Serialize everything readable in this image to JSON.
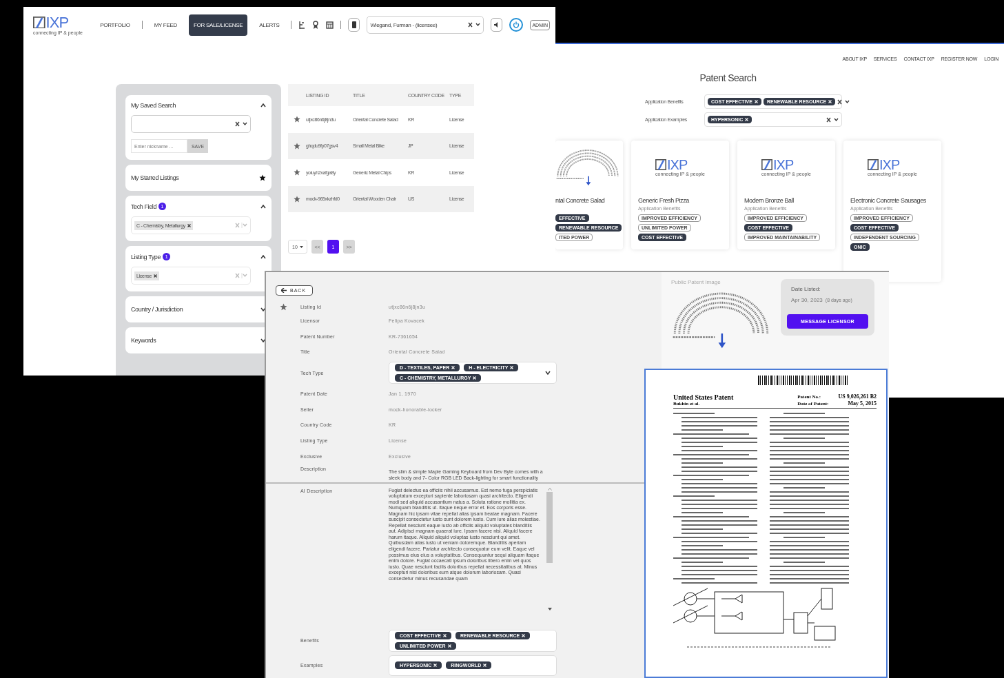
{
  "app_window": {
    "logo": {
      "mark": "IXP",
      "tagline": "connecting IP & people"
    },
    "nav": [
      {
        "label": "PORTFOLIO",
        "selected": false
      },
      {
        "label": "MY FEED",
        "selected": false
      },
      {
        "label": "FOR SALE/LICENSE",
        "selected": true
      },
      {
        "label": "ALERTS",
        "selected": false
      }
    ],
    "user_select": {
      "value": "Wiegand, Furman - (licensee)"
    },
    "admin": "ADMIN",
    "filters": [
      {
        "kind": "saved_search",
        "title": "My Saved Search",
        "expanded": true,
        "nickname_placeholder": "Enter nickname ...",
        "save": "SAVE"
      },
      {
        "kind": "starred",
        "title": "My Starred Listings"
      },
      {
        "kind": "select",
        "title": "Tech Field",
        "count": "1",
        "expanded": true,
        "chips": [
          "C - Chemistry, Metallurgy"
        ]
      },
      {
        "kind": "select",
        "title": "Listing Type",
        "count": "1",
        "expanded": true,
        "chips": [
          "License"
        ]
      },
      {
        "kind": "select",
        "title": "Country / Jurisdiction",
        "expanded": false
      },
      {
        "kind": "select",
        "title": "Keywords",
        "expanded": false
      }
    ],
    "table": {
      "columns": [
        "LISTING ID",
        "TITLE",
        "COUNTRY CODE",
        "TYPE"
      ],
      "rows": [
        [
          "utjxc86n6j8jn3u",
          "Oriental Concrete Salad",
          "KR",
          "License"
        ],
        [
          "ghqdu9fp07gsv4",
          "Small Metal Bike",
          "JP",
          "License"
        ],
        [
          "yoiuyh2xafga8y",
          "Generic Metal Chips",
          "KR",
          "License"
        ],
        [
          "mock-965xkzhfd0",
          "Oriental Wooden Chair",
          "US",
          "License"
        ]
      ]
    },
    "pagination": {
      "page_size": "10",
      "prev": "<<",
      "next": ">>",
      "pages": [
        {
          "label": "1",
          "selected": true
        }
      ]
    }
  },
  "search_window": {
    "nav": [
      "ABOUT IXP",
      "SERVICES",
      "CONTACT IXP",
      "REGISTER NOW",
      "LOGIN"
    ],
    "title": "Patent Search",
    "filters": [
      {
        "label": "Application Benefits",
        "chips": [
          "COST EFFECTIVE",
          "RENEWABLE RESOURCE"
        ]
      },
      {
        "label": "Application Examples",
        "chips": [
          "HYPERSONIC"
        ]
      }
    ],
    "cards": [
      {
        "image": {
          "kind": "drawing"
        },
        "title": "ntal Concrete Salad",
        "chips": [
          {
            "label": "EFFECTIVE",
            "kind": "filled"
          },
          {
            "label": "RENEWABLE RESOURCE",
            "kind": "filled"
          },
          {
            "label": "ITED POWER",
            "kind": "outline"
          }
        ]
      },
      {
        "image": {
          "kind": "logo",
          "mark": "IXP",
          "tagline": "connecting IP & people"
        },
        "title": "Generic Fresh Pizza",
        "benefits_label": "Application Benefits",
        "chips": [
          {
            "label": "IMPROVED EFFICIENCY",
            "kind": "outline"
          },
          {
            "label": "UNLIMITED POWER",
            "kind": "outline"
          },
          {
            "label": "COST EFFECTIVE",
            "kind": "filled"
          }
        ]
      },
      {
        "image": {
          "kind": "logo",
          "mark": "IXP",
          "tagline": "connecting IP & people"
        },
        "title": "Modern Bronze Ball",
        "benefits_label": "Application Benefits",
        "chips": [
          {
            "label": "IMPROVED EFFICIENCY",
            "kind": "outline"
          },
          {
            "label": "COST EFFECTIVE",
            "kind": "filled"
          },
          {
            "label": "IMPROVED MAINTAINABILITY",
            "kind": "outline"
          }
        ]
      },
      {
        "image": {
          "kind": "logo",
          "mark": "IXP",
          "tagline": "connecting IP & people"
        },
        "title": "Electronic Concrete Sausages",
        "benefits_label": "Application Benefits",
        "chips": [
          {
            "label": "IMPROVED EFFICIENCY",
            "kind": "outline"
          },
          {
            "label": "COST EFFECTIVE",
            "kind": "filled"
          },
          {
            "label": "INDEPENDENT SOURCING",
            "kind": "outline"
          },
          {
            "label": "ONIC",
            "kind": "filled"
          }
        ]
      }
    ]
  },
  "detail_window": {
    "back": "BACK",
    "fields": [
      {
        "kind": "text",
        "label": "Listing Id",
        "value": "utjxc86n6j8jn3u"
      },
      {
        "kind": "text",
        "label": "Licensor",
        "value": "Felipa  Kovacek"
      },
      {
        "kind": "text",
        "label": "Patent Number",
        "value": "KR-7361654"
      },
      {
        "kind": "text",
        "label": "Title",
        "value": "Oriental Concrete Salad"
      },
      {
        "kind": "chips",
        "label": "Tech Type",
        "chips": [
          "D - TEXTILES, PAPER",
          "H - ELECTRICITY",
          "C - CHEMISTRY, METALLURGY"
        ]
      },
      {
        "kind": "text",
        "label": "Patent Date",
        "value": "Jan 1, 1970"
      },
      {
        "kind": "text",
        "label": "Seller",
        "value": "mock-honorable-locker"
      },
      {
        "kind": "text",
        "label": "Country Code",
        "value": "KR"
      },
      {
        "kind": "text",
        "label": "Listing Type",
        "value": "License"
      },
      {
        "kind": "text",
        "label": "Exclusive",
        "value": "Exclusive"
      },
      {
        "kind": "paragraph",
        "label": "Description",
        "value": "The slim & simple Maple Gaming Keyboard from Dev Byte comes with a sleek body and 7- Color RGB LED Back-lighting for smart functionality"
      },
      {
        "kind": "scroll",
        "label": "AI Description",
        "value": "Fugiat delectus ea officiis nihil accusamus. Est nemo fuga perspiciatis voluptatum excepturi sapiente laboriosam quasi architecto. Eligendi modi sed aliquid accusantium natus a. Soluta ratione mollitia ex. Numquam blanditiis ut. Itaque neque error et. Eos corporis esse. Magnam hic ipsam vitae repellat alias ipsam beatae magnam. Facere suscipit consectetur iusto sunt dolorem iusto. Cum iure alias molestiae. Repellat nesciunt eaque iusto ab officiis aliquid voluptates blanditiis aut. Adipisci magnam quaerat iure. Ipsam facere nisi. Aliquid facere harum itaque. Aliquid aliquid voluptas iusto nesciunt qui amet. Quibusdam alias iusto ut veniam doloremque. Blanditiis aperiam eligendi facere. Pariatur architecto consequatur eum velit. Eaque vel possimus eius eius a voluptatibus. Consequuntur sequi aliquam itaque enim dolore. Fugiat occaecati ipsum doloribus libero enim vel quos iusto. Quae nesciunt facilis doloribus repellat necessitatibus at. Minus excepturi nisi doloribus eum atque dolorum laboriosam. Quasi consectetur minus recusandae quam"
      },
      {
        "kind": "chips",
        "label": "Benefits",
        "chips": [
          "COST EFFECTIVE",
          "RENEWABLE RESOURCE",
          "UNLIMITED POWER"
        ]
      },
      {
        "kind": "chips",
        "label": "Examples",
        "chips": [
          "HYPERSONIC",
          "RINGWORLD"
        ]
      }
    ],
    "image_label": "Public Patent Image",
    "date_label": "Date Listed:",
    "date": "Apr 30, 2023",
    "date_ago": "(8 days ago)",
    "message": "MESSAGE LICENSOR"
  },
  "patent_document": {
    "title": "United States Patent",
    "inventors": "Bukhin et al.",
    "number_label": "Patent No.:",
    "number": "US 9,026,261 B2",
    "date_label": "Date of Patent:",
    "date": "May 5, 2015"
  }
}
